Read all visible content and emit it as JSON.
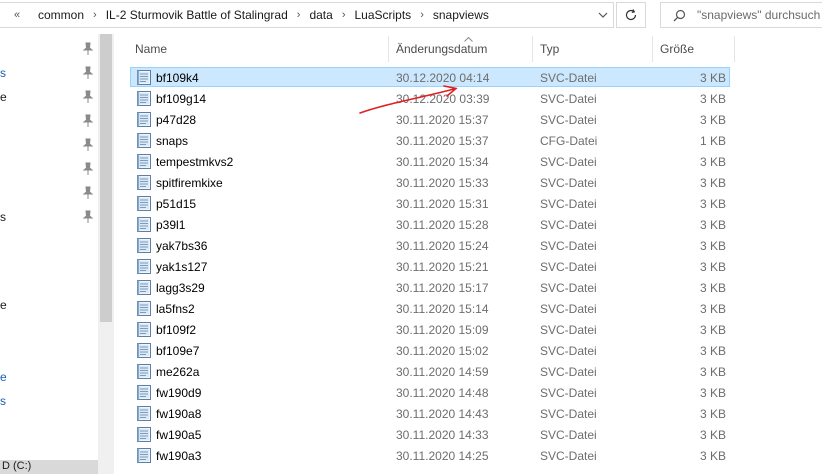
{
  "address_bar": {
    "overflow_glyph": "«",
    "breadcrumbs": [
      "common",
      "IL-2 Sturmovik Battle of Stalingrad",
      "data",
      "LuaScripts",
      "snapviews"
    ]
  },
  "search": {
    "placeholder": "\"snapviews\" durchsuch"
  },
  "nav_pane": {
    "fragments": [
      {
        "text": "s",
        "blue": true
      },
      {
        "text": "e",
        "blue": false
      },
      {
        "text": "s",
        "blue": false
      },
      {
        "text": "e",
        "blue": false
      },
      {
        "text": "e",
        "blue": true
      },
      {
        "text": "s",
        "blue": true
      }
    ],
    "drive_label": "D (C:)"
  },
  "columns": {
    "name": "Name",
    "date": "Änderungsdatum",
    "type": "Typ",
    "size": "Größe"
  },
  "files": [
    {
      "name": "bf109k4",
      "date": "30.12.2020 04:14",
      "type": "SVC-Datei",
      "size": "3 KB",
      "selected": true
    },
    {
      "name": "bf109g14",
      "date": "30.12.2020 03:39",
      "type": "SVC-Datei",
      "size": "3 KB"
    },
    {
      "name": "p47d28",
      "date": "30.11.2020 15:37",
      "type": "SVC-Datei",
      "size": "3 KB"
    },
    {
      "name": "snaps",
      "date": "30.11.2020 15:37",
      "type": "CFG-Datei",
      "size": "1 KB"
    },
    {
      "name": "tempestmkvs2",
      "date": "30.11.2020 15:34",
      "type": "SVC-Datei",
      "size": "3 KB"
    },
    {
      "name": "spitfiremkixe",
      "date": "30.11.2020 15:33",
      "type": "SVC-Datei",
      "size": "3 KB"
    },
    {
      "name": "p51d15",
      "date": "30.11.2020 15:31",
      "type": "SVC-Datei",
      "size": "3 KB"
    },
    {
      "name": "p39l1",
      "date": "30.11.2020 15:28",
      "type": "SVC-Datei",
      "size": "3 KB"
    },
    {
      "name": "yak7bs36",
      "date": "30.11.2020 15:24",
      "type": "SVC-Datei",
      "size": "3 KB"
    },
    {
      "name": "yak1s127",
      "date": "30.11.2020 15:21",
      "type": "SVC-Datei",
      "size": "3 KB"
    },
    {
      "name": "lagg3s29",
      "date": "30.11.2020 15:17",
      "type": "SVC-Datei",
      "size": "3 KB"
    },
    {
      "name": "la5fns2",
      "date": "30.11.2020 15:14",
      "type": "SVC-Datei",
      "size": "3 KB"
    },
    {
      "name": "bf109f2",
      "date": "30.11.2020 15:09",
      "type": "SVC-Datei",
      "size": "3 KB"
    },
    {
      "name": "bf109e7",
      "date": "30.11.2020 15:02",
      "type": "SVC-Datei",
      "size": "3 KB"
    },
    {
      "name": "me262a",
      "date": "30.11.2020 14:59",
      "type": "SVC-Datei",
      "size": "3 KB"
    },
    {
      "name": "fw190d9",
      "date": "30.11.2020 14:48",
      "type": "SVC-Datei",
      "size": "3 KB"
    },
    {
      "name": "fw190a8",
      "date": "30.11.2020 14:43",
      "type": "SVC-Datei",
      "size": "3 KB"
    },
    {
      "name": "fw190a5",
      "date": "30.11.2020 14:33",
      "type": "SVC-Datei",
      "size": "3 KB"
    },
    {
      "name": "fw190a3",
      "date": "30.11.2020 14:25",
      "type": "SVC-Datei",
      "size": "3 KB"
    }
  ],
  "colors": {
    "selection_bg": "#cce8ff",
    "selection_border": "#99d1ff",
    "annotation": "#e02020"
  },
  "icons": {
    "file": "text-file-icon",
    "pin": "pin-icon",
    "search": "search-icon",
    "refresh": "refresh-icon",
    "chevron": "chevron-down-icon"
  }
}
